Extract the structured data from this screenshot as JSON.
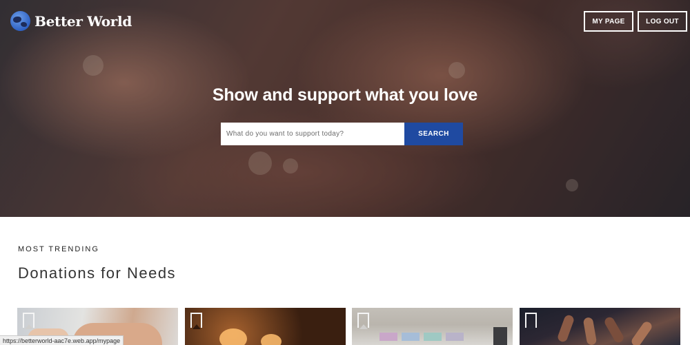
{
  "header": {
    "brand": "Better World",
    "logo_icon": "globe-icon",
    "my_page_label": "MY PAGE",
    "logout_label": "LOG OUT"
  },
  "hero": {
    "headline": "Show and support what you love",
    "search_placeholder": "What do you want to support today?",
    "search_button_label": "SEARCH"
  },
  "section": {
    "eyebrow": "MOST TRENDING",
    "title": "Donations for Needs"
  },
  "cards": [
    {
      "bookmark_icon": "bookmark-icon"
    },
    {
      "bookmark_icon": "bookmark-icon"
    },
    {
      "bookmark_icon": "bookmark-icon"
    },
    {
      "bookmark_icon": "bookmark-icon"
    }
  ],
  "status_bar": {
    "url": "https://betterworld-aac7e.web.app/mypage"
  },
  "colors": {
    "accent": "#1f4aa1",
    "text_dark": "#333333"
  }
}
